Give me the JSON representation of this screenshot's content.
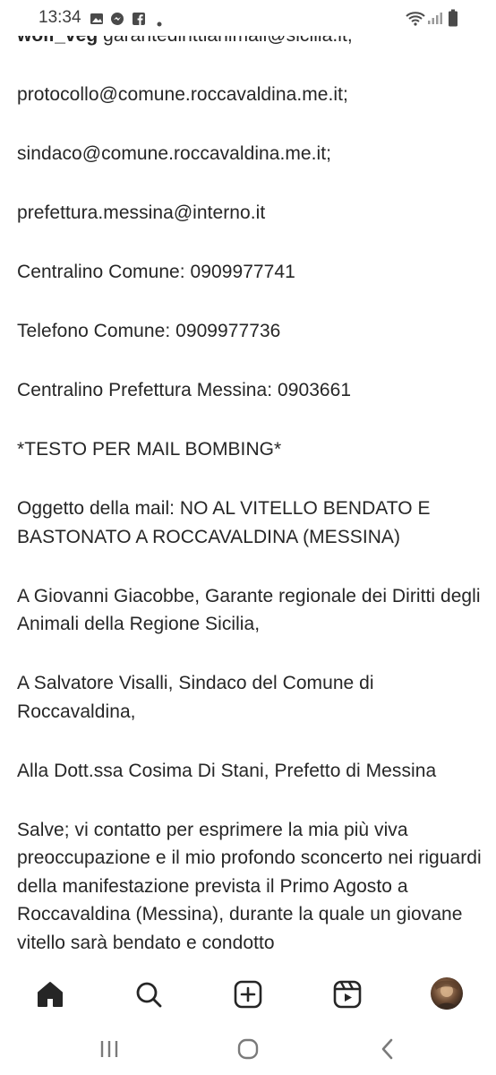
{
  "status_bar": {
    "time": "13:34",
    "icons": [
      "gallery-icon",
      "messenger-icon",
      "facebook-icon",
      "dot-icon",
      "wifi-icon",
      "signal-icon",
      "battery-icon"
    ]
  },
  "post": {
    "username": "wolf_veg",
    "first_line_rest": " garantedirittianimali@sicilia.it,",
    "paragraphs": [
      "protocollo@comune.roccavaldina.me.it;",
      "sindaco@comune.roccavaldina.me.it;",
      "prefettura.messina@interno.it",
      "Centralino Comune: 0909977741",
      "Telefono Comune: 0909977736",
      "Centralino Prefettura Messina: 0903661",
      "*TESTO PER MAIL BOMBING*",
      "Oggetto della mail: NO AL VITELLO BENDATO E BASTONATO A ROCCAVALDINA (MESSINA)",
      "A Giovanni Giacobbe, Garante regionale dei Diritti degli Animali della Regione Sicilia,",
      "A Salvatore Visalli, Sindaco del Comune di Roccavaldina,",
      "Alla Dott.ssa Cosima Di Stani, Prefetto di Messina",
      "Salve; vi contatto per esprimere la mia più viva preoccupazione e il mio profondo sconcerto nei riguardi della manifestazione prevista il Primo Agosto a Roccavaldina (Messina), durante la quale un giovane vitello sarà bendato e condotto"
    ]
  },
  "bottom_nav": {
    "items": [
      "home-icon",
      "search-icon",
      "create-icon",
      "reels-icon",
      "profile-avatar"
    ],
    "active": "home-icon"
  },
  "system_nav": {
    "items": [
      "recents-icon",
      "home-circle-icon",
      "back-icon"
    ]
  },
  "colors": {
    "text": "#262626",
    "icon": "#262626",
    "status_text": "#3c3c3c",
    "background": "#ffffff"
  }
}
